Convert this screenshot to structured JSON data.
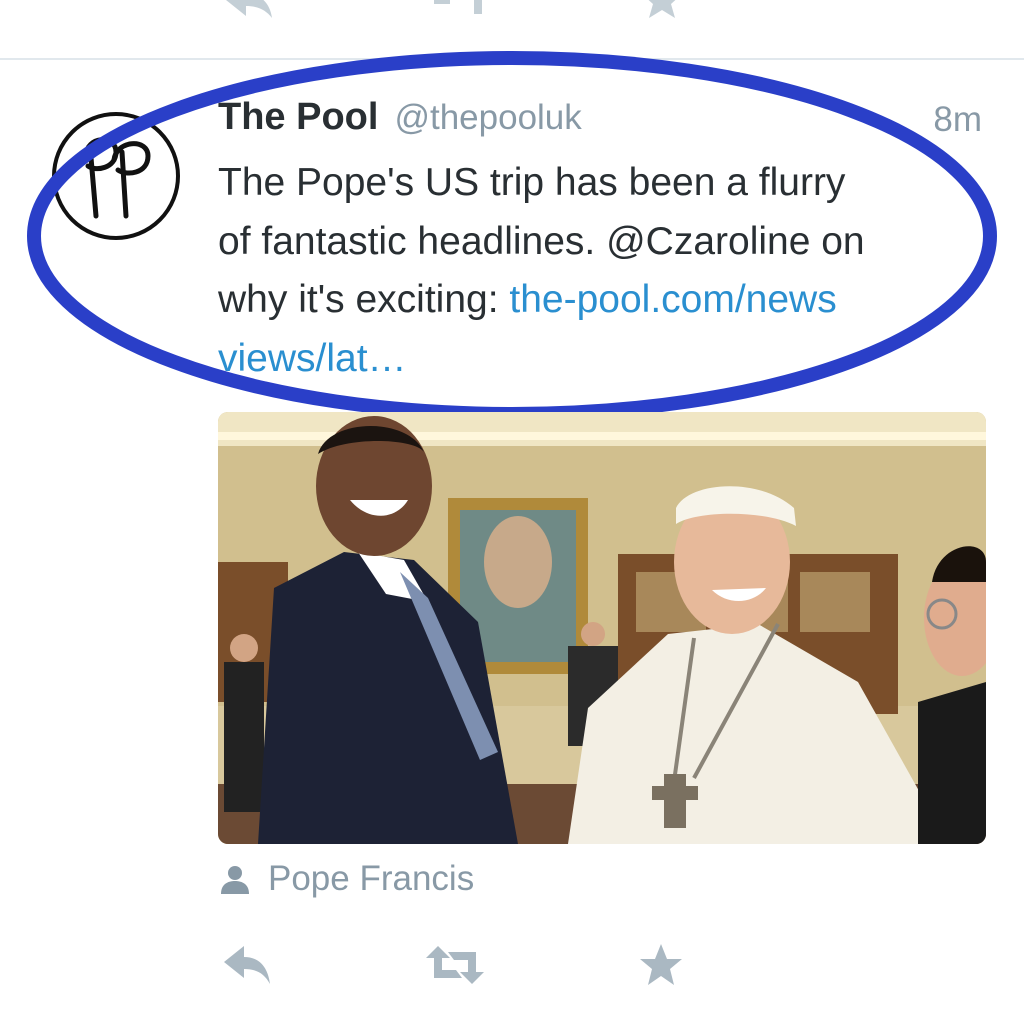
{
  "tweet": {
    "name": "The Pool",
    "handle": "@thepooluk",
    "time": "8m",
    "text_lines": [
      "The Pope's US trip has been a flurry",
      "of fantastic headlines. @Czaroline on",
      "why it's exciting: "
    ],
    "link_part1": "the-pool.com/news",
    "link_part2": "views/lat…",
    "photo_tag": "Pope Francis"
  },
  "icons": {
    "reply": "reply-icon",
    "retweet": "retweet-icon",
    "favorite": "star-icon",
    "person": "person-icon"
  },
  "colors": {
    "highlight": "#2a3fc8",
    "link": "#2a8fd0",
    "muted": "#8899a6",
    "action_icons": "#aab8c2"
  }
}
